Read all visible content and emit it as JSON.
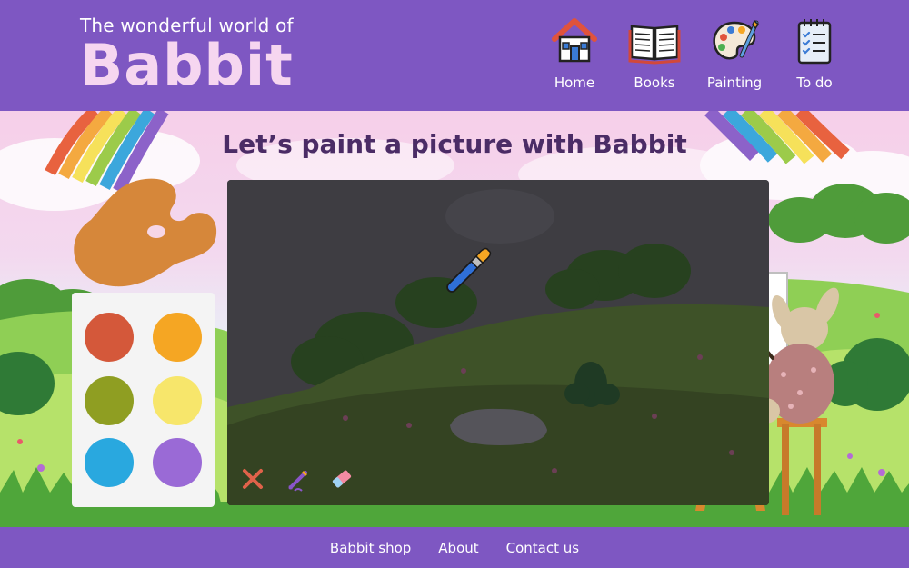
{
  "brand": {
    "subtitle": "The wonderful world of",
    "name": "Babbit"
  },
  "nav": {
    "items": [
      {
        "label": "Home",
        "icon": "house-icon"
      },
      {
        "label": "Books",
        "icon": "open-book-icon"
      },
      {
        "label": "Painting",
        "icon": "paint-palette-icon"
      },
      {
        "label": "To do",
        "icon": "checklist-icon"
      }
    ]
  },
  "main": {
    "title": "Let’s paint a picture with Babbit"
  },
  "palette": {
    "colors": [
      "#d4583a",
      "#f5a623",
      "#8f9e22",
      "#f7e66b",
      "#29a8df",
      "#9a6ad6"
    ]
  },
  "canvas_tools": [
    {
      "name": "clear-tool",
      "icon": "close-icon"
    },
    {
      "name": "brush-tool",
      "icon": "brush-icon"
    },
    {
      "name": "eraser-tool",
      "icon": "eraser-icon"
    }
  ],
  "footer": {
    "links": [
      "Babbit shop",
      "About",
      "Contact us"
    ]
  },
  "colors": {
    "header_bg": "#7e57c2",
    "title_color": "#4b2c66",
    "brand_accent": "#f6d6f0"
  }
}
